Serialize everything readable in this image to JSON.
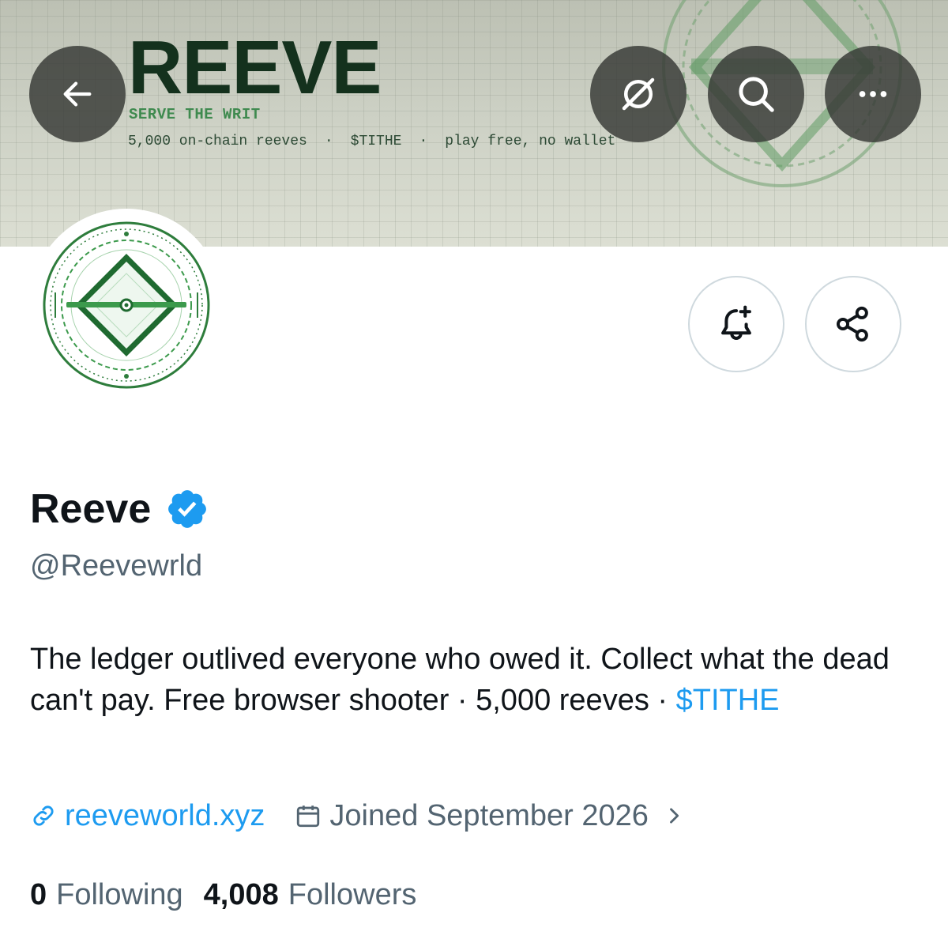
{
  "banner": {
    "title": "REEVE",
    "tagline": "SERVE THE WRIT",
    "meta": [
      "5,000 on-chain reeves",
      "$TITHE",
      "play free, no wallet"
    ],
    "separator": "·",
    "colors": {
      "title": "#14311d",
      "tagline": "#3f8a4f",
      "emblem": "#5f9a63"
    }
  },
  "nav": {
    "back_icon": "arrow-left-icon",
    "hide_icon": "eye-slash-circle-icon",
    "search_icon": "search-icon",
    "more_icon": "ellipsis-icon"
  },
  "profile": {
    "display_name": "Reeve",
    "verified": true,
    "handle": "@Reevewrld",
    "bio_text": "The ledger outlived everyone who owed it. Collect what the dead can't pay. Free browser shooter · 5,000 reeves · ",
    "bio_link": "$TITHE",
    "website": "reeveworld.xyz",
    "joined": "Joined September 2026",
    "following_count": "0",
    "following_label": "Following",
    "followers_count": "4,008",
    "followers_label": "Followers"
  },
  "actions": {
    "notify_icon": "bell-plus-icon",
    "share_icon": "share-icon"
  },
  "colors": {
    "link": "#1d9bf0",
    "secondary_text": "#536471",
    "primary_text": "#0f1419",
    "verified_badge": "#1d9bf0",
    "avatar_green": "#2e7d3c"
  }
}
